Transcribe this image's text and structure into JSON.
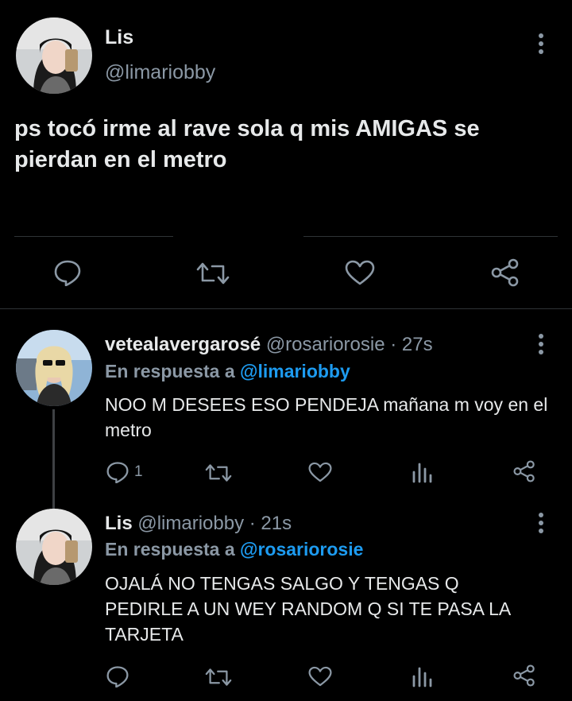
{
  "main_tweet": {
    "author_name": "Lis",
    "author_handle": "@limariobby",
    "text": "ps tocó irme al rave sola q mis AMIGAS se pierdan en el metro"
  },
  "replies": [
    {
      "author_name": "vetealavergarosé",
      "author_handle": "@rosariorosie",
      "time": "· 27s",
      "reply_to_prefix": "En respuesta a ",
      "reply_to_handle": "@limariobby",
      "text": "NOO M DESEES ESO PENDEJA mañana m voy en el metro",
      "reply_count": "1"
    },
    {
      "author_name": "Lis",
      "author_handle": "@limariobby",
      "time": "· 21s",
      "reply_to_prefix": "En respuesta a ",
      "reply_to_handle": "@rosariorosie",
      "text": "OJALÁ NO TENGAS SALGO Y TENGAS Q PEDIRLE A UN WEY RANDOM Q SI TE PASA LA TARJETA",
      "reply_count": ""
    }
  ],
  "icons": [
    "reply-icon",
    "retweet-icon",
    "like-icon",
    "analytics-icon",
    "share-icon",
    "more-options-icon"
  ],
  "colors": {
    "background": "#000000",
    "text": "#e7e9ea",
    "secondary": "#8b98a5",
    "accent": "#1d9bf0",
    "divider": "#2f3336"
  }
}
